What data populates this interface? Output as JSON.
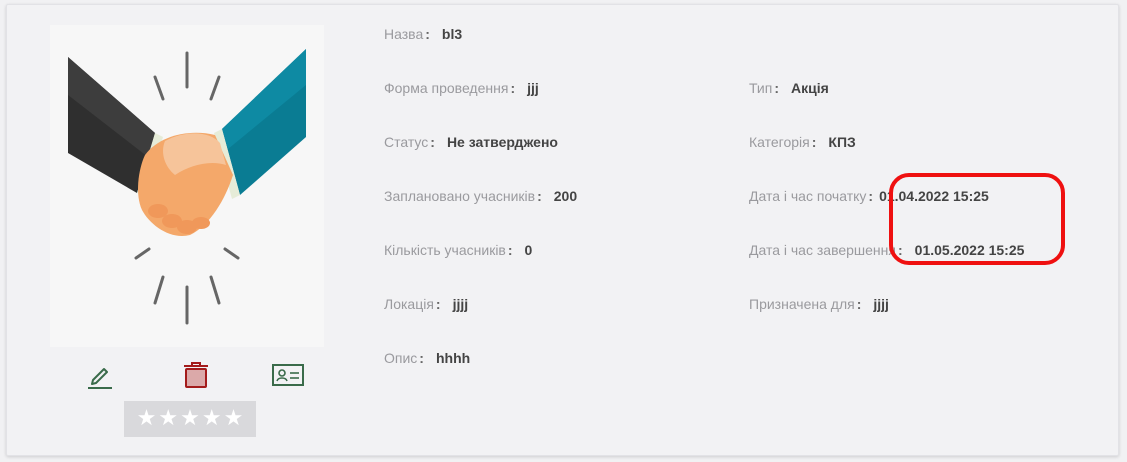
{
  "item": {
    "image_icon": "handshake-illustration",
    "actions": [
      {
        "name": "edit-button",
        "icon": "pencil-icon",
        "color": "#3a6b4a"
      },
      {
        "name": "delete-button",
        "icon": "trash-icon",
        "color": "#a31b1b"
      },
      {
        "name": "details-button",
        "icon": "id-card-icon",
        "color": "#3a6b4a"
      }
    ],
    "rating": {
      "stars": 5,
      "filled": 0,
      "icon": "star-icon",
      "background": "#d9d9dc"
    }
  },
  "fields_left": [
    {
      "label": "Назва",
      "value": "bl3"
    },
    {
      "label": "Форма проведення",
      "value": "jjj"
    },
    {
      "label": "Статус",
      "value": "Не затверджено"
    },
    {
      "label": "Заплановано учасників",
      "value": "200"
    },
    {
      "label": "Кількість учасників",
      "value": "0"
    },
    {
      "label": "Локація",
      "value": "jjjj"
    },
    {
      "label": "Опис",
      "value": "hhhh"
    }
  ],
  "fields_right": [
    {
      "label": "Тип",
      "value": "Акція"
    },
    {
      "label": "Категорія",
      "value": "КПЗ"
    },
    {
      "label": "Дата і час початку",
      "value": "01.04.2022 15:25"
    },
    {
      "label": "Дата і час завершення",
      "value": "01.05.2022 15:25"
    },
    {
      "label": "Призначена для",
      "value": "jjjj"
    }
  ],
  "highlight": {
    "color": "#ef1010"
  }
}
